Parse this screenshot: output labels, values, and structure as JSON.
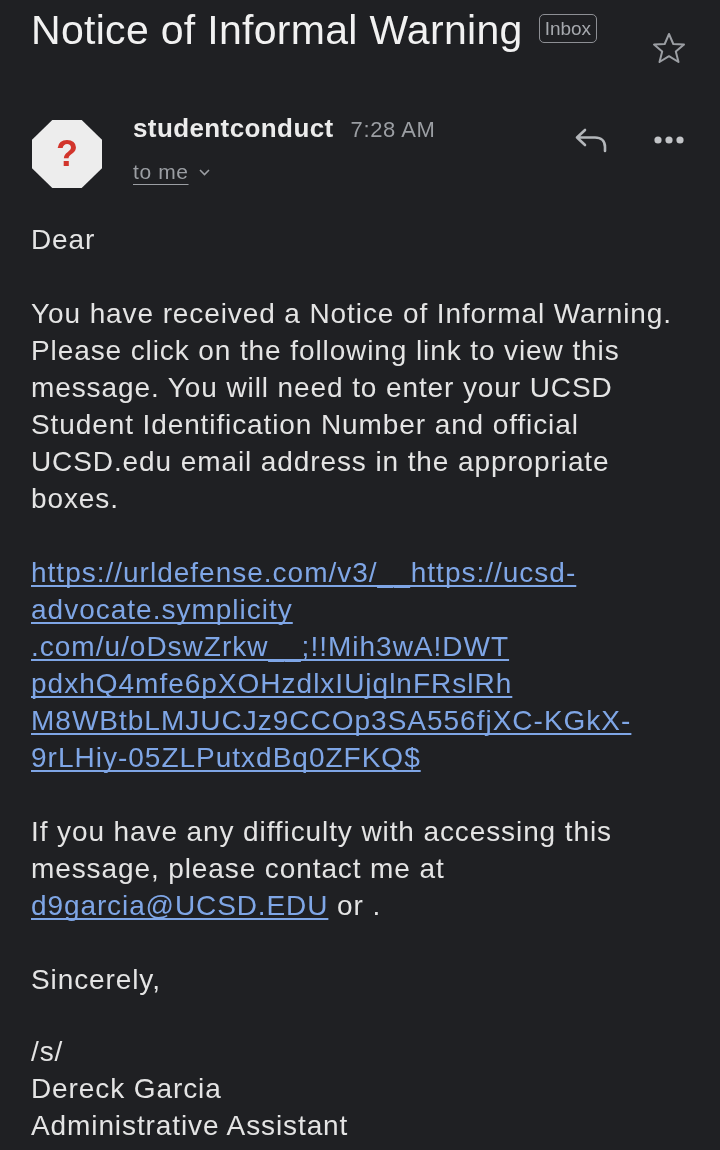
{
  "header": {
    "subject": "Notice of Informal Warning",
    "label": "Inbox",
    "starred": false
  },
  "message": {
    "avatar": "?",
    "sender": "studentconduct",
    "time": "7:28 AM",
    "recipients": "to me"
  },
  "body": {
    "greeting": "Dear",
    "paragraph": "You have received a Notice of Informal Warning. Please click on the following link to view this message. You will need to enter your UCSD Student Identification Number and official UCSD.edu email address in the appropriate boxes.",
    "link_lines": [
      "https://urldefense.com/v3/__https://ucsd-",
      "advocate.symplicity",
      ".com/u/oDswZrkw__;!!Mih3wA!DWT",
      "pdxhQ4mfe6pXOHzdlxIUjqlnFRslRh",
      "M8WBtbLMJUCJz9CCOp3SA556fjXC-KGkX-",
      "9rLHiy-05ZLPutxdBq0ZFKQ$"
    ],
    "contact": {
      "text": "If you have any difficulty with accessing this message, please contact me at",
      "email": "d9garcia@UCSD.EDU",
      "after": "or ."
    },
    "closing": "Sincerely,",
    "signature": [
      "/s/",
      "Dereck Garcia",
      "Administrative Assistant"
    ]
  }
}
